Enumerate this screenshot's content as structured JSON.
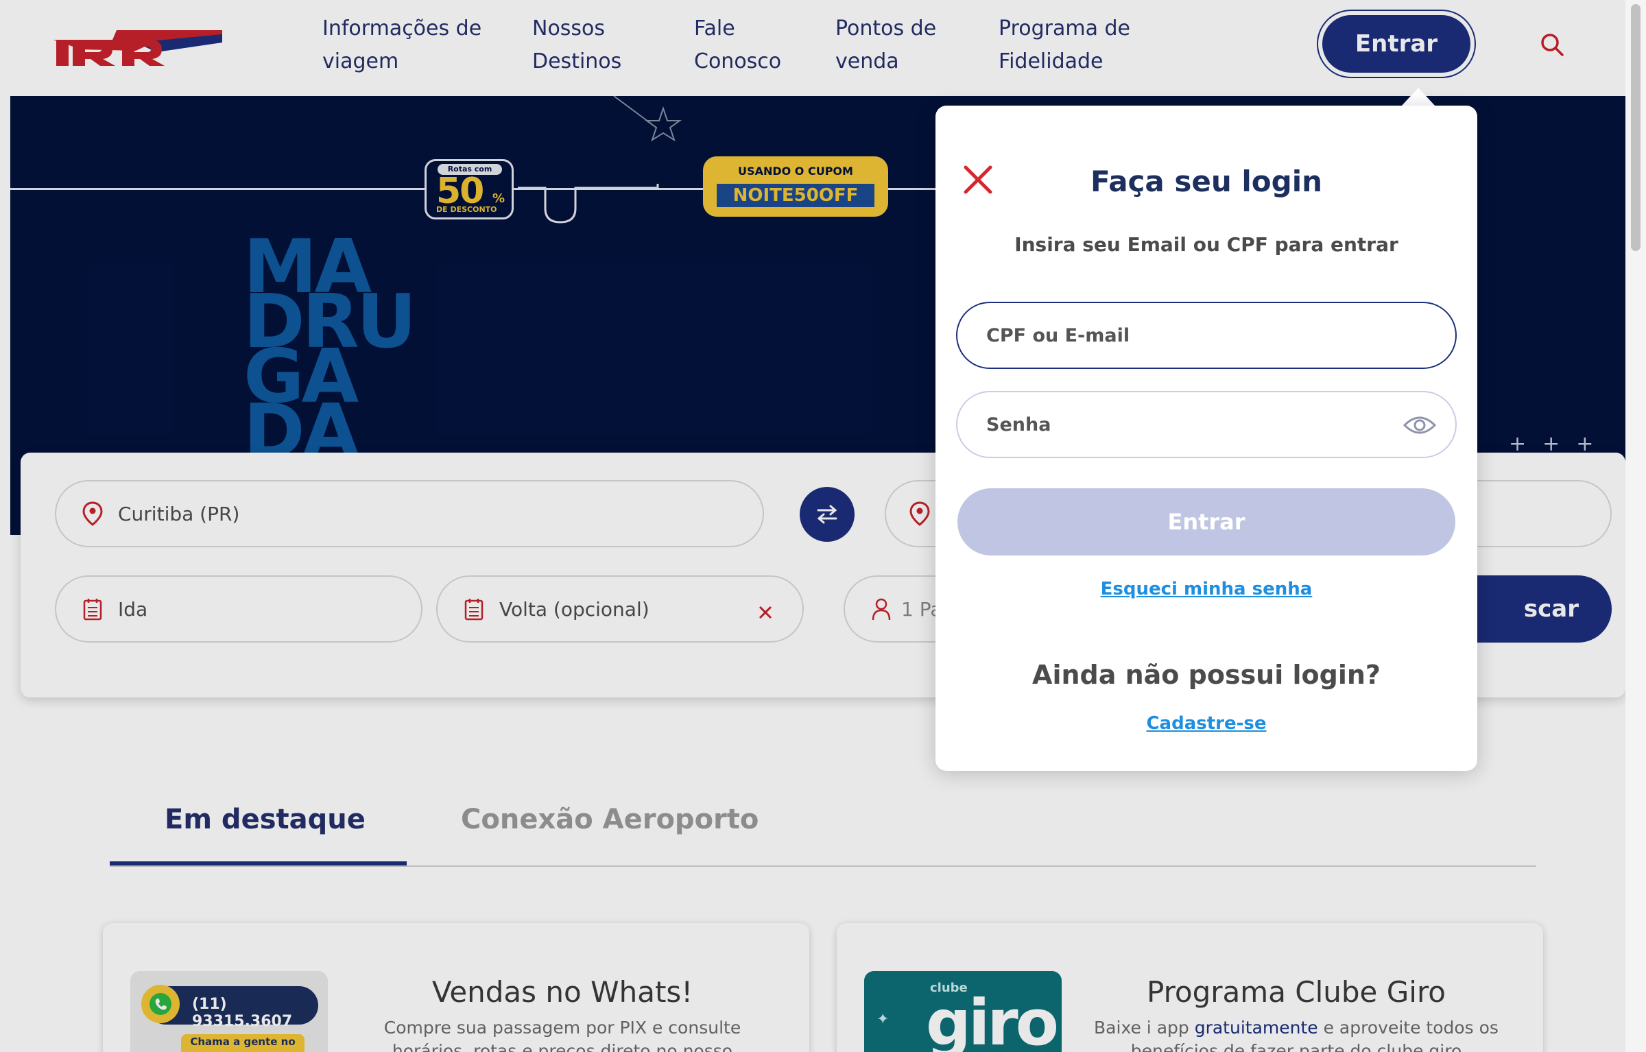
{
  "header": {
    "nav": [
      {
        "line1": "Informações de",
        "line2": "viagem"
      },
      {
        "line1": "Nossos",
        "line2": "Destinos"
      },
      {
        "line1": "Fale",
        "line2": "Conosco"
      },
      {
        "line1": "Pontos de",
        "line2": "venda"
      },
      {
        "line1": "Programa de",
        "line2": "Fidelidade"
      }
    ],
    "login_button": "Entrar"
  },
  "hero": {
    "badge_top": "Rotas com",
    "badge_value": "50",
    "badge_pct": "%",
    "badge_bottom": "DE DESCONTO",
    "coupon_label": "USANDO O CUPOM",
    "coupon_code": "NOITE50OFF",
    "headline": [
      "MA",
      "DRU",
      "GA",
      "DA"
    ]
  },
  "search": {
    "origin": "Curitiba (PR)",
    "depart": "Ida",
    "return": "Volta (opcional)",
    "passengers": "1 Pa",
    "search_button": "scar"
  },
  "tabs": [
    "Em destaque",
    "Conexão Aeroporto"
  ],
  "cards": [
    {
      "title": "Vendas no Whats!",
      "text": "Compre sua passagem por PIX e consulte horários, rotas e preços direto no nosso WhatsApp",
      "img_phone": "(11) 93315.3607",
      "img_caption": "Chama a gente no"
    },
    {
      "title": "Programa Clube Giro",
      "text_before": "Baixe i app ",
      "text_link": "gratuitamente",
      "text_after": " e aproveite todos os benefícios de fazer parte do clube giro",
      "img_small": "clube",
      "img_big": "giro"
    }
  ],
  "login": {
    "title": "Faça seu login",
    "subtitle": "Insira seu Email ou CPF para entrar",
    "email_placeholder": "CPF ou E-mail",
    "password_placeholder": "Senha",
    "submit": "Entrar",
    "forgot": "Esqueci minha senha",
    "no_account": "Ainda não possui login?",
    "register": "Cadastre-se"
  },
  "colors": {
    "brand_blue": "#1c2f7e",
    "brand_red": "#d7262e",
    "link_blue": "#1e8ee0",
    "hero_navy": "#03123c",
    "coupon_yellow": "#f4c737"
  },
  "icons": [
    "logo",
    "search-icon",
    "close-icon",
    "eye-icon",
    "pin-icon",
    "swap-icon",
    "calendar-icon",
    "clear-icon",
    "user-icon",
    "whatsapp-icon"
  ]
}
